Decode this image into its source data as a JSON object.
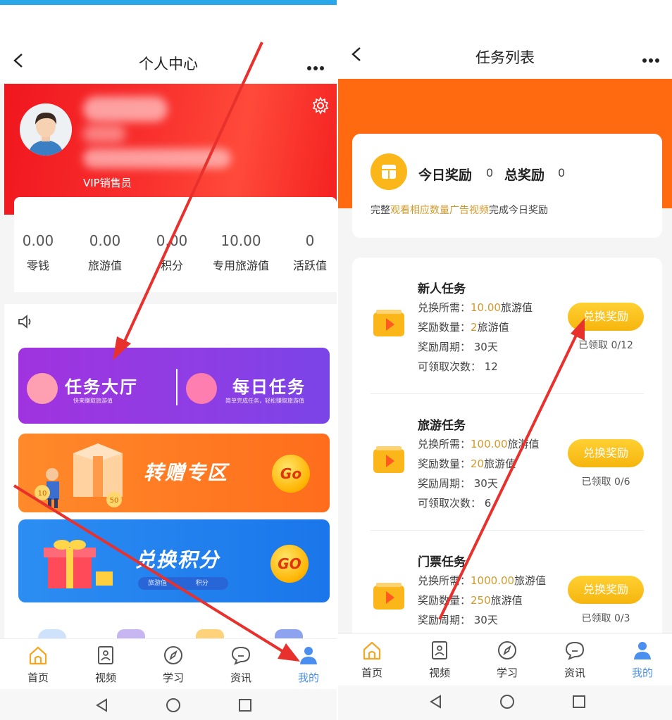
{
  "left": {
    "nav": {
      "title": "个人中心"
    },
    "profile": {
      "role": "VIP销售员"
    },
    "stats": [
      {
        "value": "0.00",
        "label": "零钱"
      },
      {
        "value": "0.00",
        "label": "旅游值"
      },
      {
        "value": "0.00",
        "label": "积分"
      },
      {
        "value": "10.00",
        "label": "专用旅游值"
      },
      {
        "value": "0",
        "label": "活跃值"
      }
    ],
    "task_hall": {
      "left_title": "任务大厅",
      "left_sub": "快来赚取旅游值",
      "right_title": "每日任务",
      "right_sub": "简单完成任务，轻松赚取旅游值"
    },
    "transfer": {
      "title": "转赠专区",
      "go": "Go",
      "coin1": "10",
      "coin2": "50"
    },
    "exchange": {
      "title": "兑换积分",
      "go": "GO",
      "pill_left": "旅游值",
      "pill_right": "积分"
    }
  },
  "right": {
    "nav": {
      "title": "任务列表"
    },
    "reward": {
      "today_label": "今日奖励",
      "today_value": "0",
      "total_label": "总奖励",
      "total_value": "0",
      "desc_prefix": "完整",
      "desc_highlight": "观看相应数量广告视频",
      "desc_suffix": "完成今日奖励"
    },
    "tasks": [
      {
        "name": "新人任务",
        "need_label": "兑换所需：",
        "need_value": "10.00",
        "need_unit": "旅游值",
        "amount_label": "奖励数量：",
        "amount_value": "2",
        "amount_unit": "旅游值",
        "period": "奖励周期：  30天",
        "times": "可领取次数：  12",
        "button": "兑换奖励",
        "status": "已领取 0/12"
      },
      {
        "name": "旅游任务",
        "need_label": "兑换所需：",
        "need_value": "100.00",
        "need_unit": "旅游值",
        "amount_label": "奖励数量：",
        "amount_value": "20",
        "amount_unit": "旅游值",
        "period": "奖励周期：  30天",
        "times": "可领取次数：  6",
        "button": "兑换奖励",
        "status": "已领取 0/6"
      },
      {
        "name": "门票任务",
        "need_label": "兑换所需：",
        "need_value": "1000.00",
        "need_unit": "旅游值",
        "amount_label": "奖励数量：",
        "amount_value": "250",
        "amount_unit": "旅游值",
        "period": "奖励周期：  30天",
        "times": "",
        "button": "兑换奖励",
        "status": "已领取 0/3"
      }
    ]
  },
  "tabs": [
    {
      "label": "首页",
      "icon": "home-icon"
    },
    {
      "label": "视频",
      "icon": "video-icon"
    },
    {
      "label": "学习",
      "icon": "compass-icon"
    },
    {
      "label": "资讯",
      "icon": "chat-icon"
    },
    {
      "label": "我的",
      "icon": "user-icon"
    }
  ],
  "colors": {
    "banner_red": "#f0161e",
    "task_purple": "#8d3ee4",
    "transfer_orange": "#ff6d1c",
    "exchange_blue": "#1a76ea",
    "header_orange": "#ff6a10",
    "highlight_gold": "#d19a2b",
    "claim_button": "#f6b50e",
    "active_tab": "#4a8ff0",
    "arrow_red": "#e8302c"
  }
}
